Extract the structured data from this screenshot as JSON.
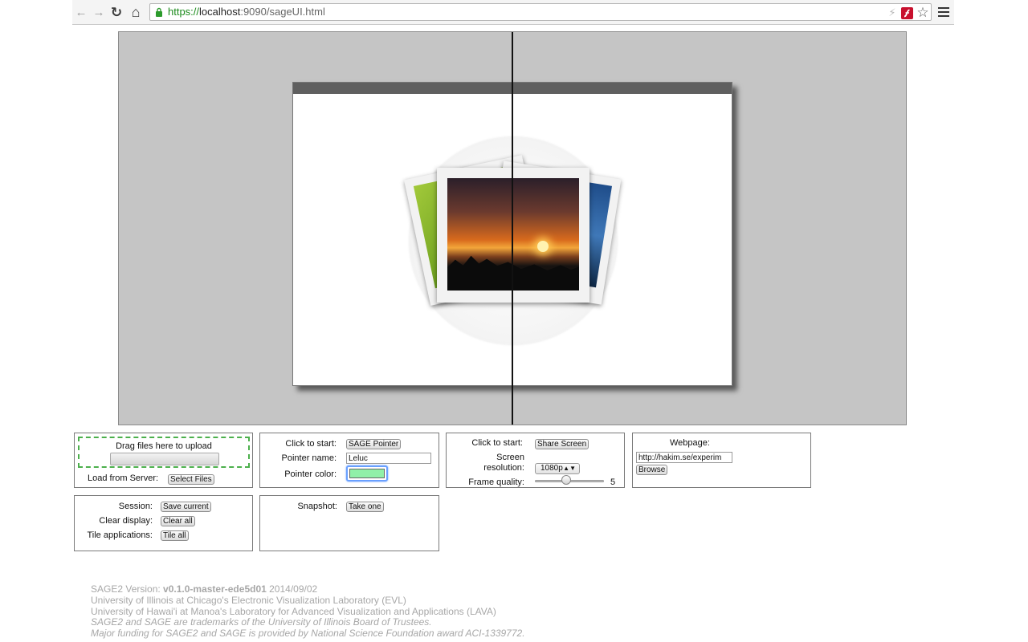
{
  "browser": {
    "url_scheme": "https://",
    "url_host": "localhost",
    "url_path": ":9090/sageUI.html",
    "back_glyph": "←",
    "forward_glyph": "→",
    "reload_glyph": "↻",
    "home_glyph": "⌂",
    "star_glyph": "☆",
    "bolt_glyph": "⚡"
  },
  "upload": {
    "drop_text": "Drag files here to upload",
    "load_label": "Load from Server:",
    "select_files": "Select Files"
  },
  "pointer": {
    "start_label": "Click to start:",
    "start_button": "SAGE Pointer",
    "name_label": "Pointer name:",
    "name_value": "Leluc",
    "color_label": "Pointer color:",
    "color": "#90f0a8"
  },
  "screen_share": {
    "start_label": "Click to start:",
    "start_button": "Share Screen",
    "resolution_label_line1": "Screen",
    "resolution_label_line2": "resolution:",
    "resolution_value": "1080p",
    "quality_label": "Frame quality:",
    "quality_value": "5",
    "quality_level": 0.45
  },
  "webpage": {
    "label": "Webpage:",
    "url_value": "http://hakim.se/experim",
    "browse_button": "Browse"
  },
  "session": {
    "session_label": "Session:",
    "save_button": "Save current",
    "clear_label": "Clear display:",
    "clear_button": "Clear all",
    "tile_label": "Tile applications:",
    "tile_button": "Tile all"
  },
  "snapshot": {
    "label": "Snapshot:",
    "button": "Take one"
  },
  "footer": {
    "version_prefix": "SAGE2 Version: ",
    "version": "v0.1.0-master-ede5d01",
    "version_date": " 2014/09/02",
    "line2": "University of Illinois at Chicago's Electronic Visualization Laboratory (EVL)",
    "line3": "University of Hawai'i at Manoa's Laboratory for Advanced Visualization and Applications (LAVA)",
    "line4": "SAGE2 and SAGE are trademarks of the University of Illinois Board of Trustees.",
    "line5": "Major funding for SAGE2 and SAGE is provided by National Science Foundation award ACI-1339772."
  }
}
